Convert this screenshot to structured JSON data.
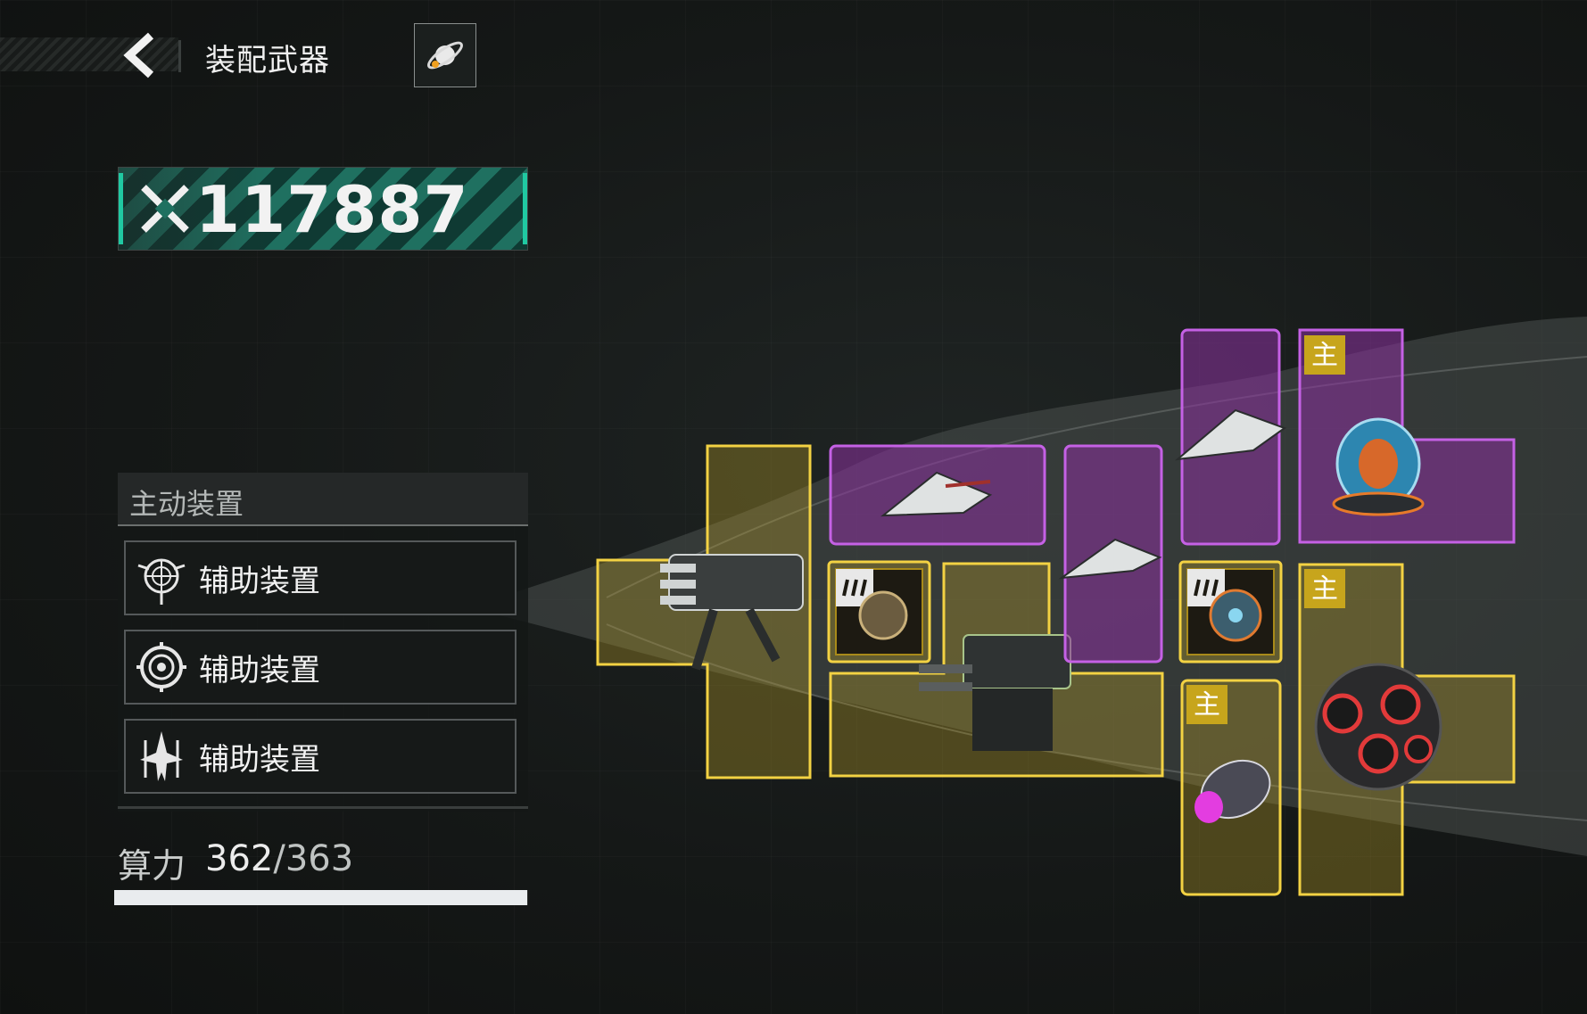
{
  "header": {
    "title": "装配武器",
    "back_icon": "back-arrow-icon",
    "planet_icon": "planet-icon"
  },
  "power": {
    "value": "117887",
    "icon": "crossed-swords-icon",
    "accent": "#20c9a2"
  },
  "panel": {
    "title": "主动装置",
    "items": [
      {
        "label": "辅助装置",
        "icon": "radar-dish-icon"
      },
      {
        "label": "辅助装置",
        "icon": "target-reticle-icon"
      },
      {
        "label": "辅助装置",
        "icon": "fighter-squadron-icon"
      }
    ]
  },
  "compute": {
    "label": "算力",
    "used": "362",
    "separator": "/",
    "total": "363",
    "fill_fraction": 0.997
  },
  "slots": {
    "main_tag": "主",
    "colors": {
      "yellow": "#f3d243",
      "purple": "#c561e5"
    }
  }
}
